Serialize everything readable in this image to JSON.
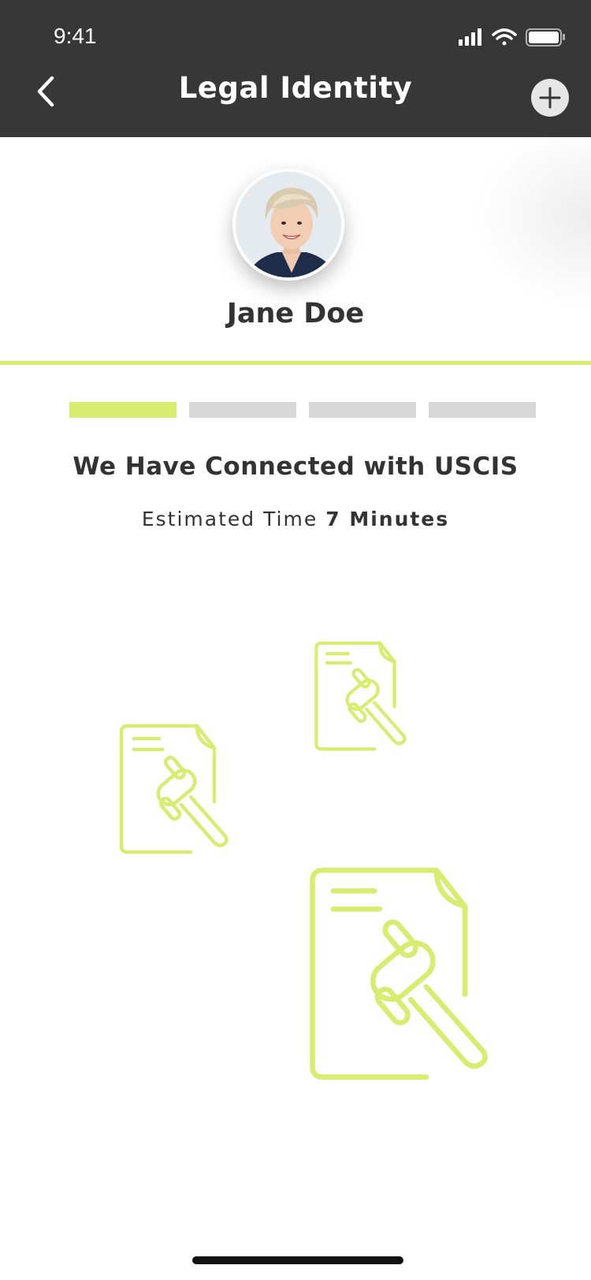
{
  "status_bar": {
    "time": "9:41"
  },
  "header": {
    "title": "Legal Identity"
  },
  "profile": {
    "name": "Jane Doe"
  },
  "progress": {
    "current_step": 1,
    "total_steps": 4
  },
  "main": {
    "headline": "We Have Connected with USCIS",
    "estimate_label": "Estimated Time",
    "estimate_value": "7 Minutes"
  },
  "icons": {
    "back": "chevron-left-icon",
    "add": "plus-circle-icon",
    "document": "legal-document-gavel-icon"
  },
  "colors": {
    "accent": "#d8ec6f",
    "header_bg": "#373737",
    "inactive_segment": "#d7d7d7",
    "text": "#333333"
  }
}
